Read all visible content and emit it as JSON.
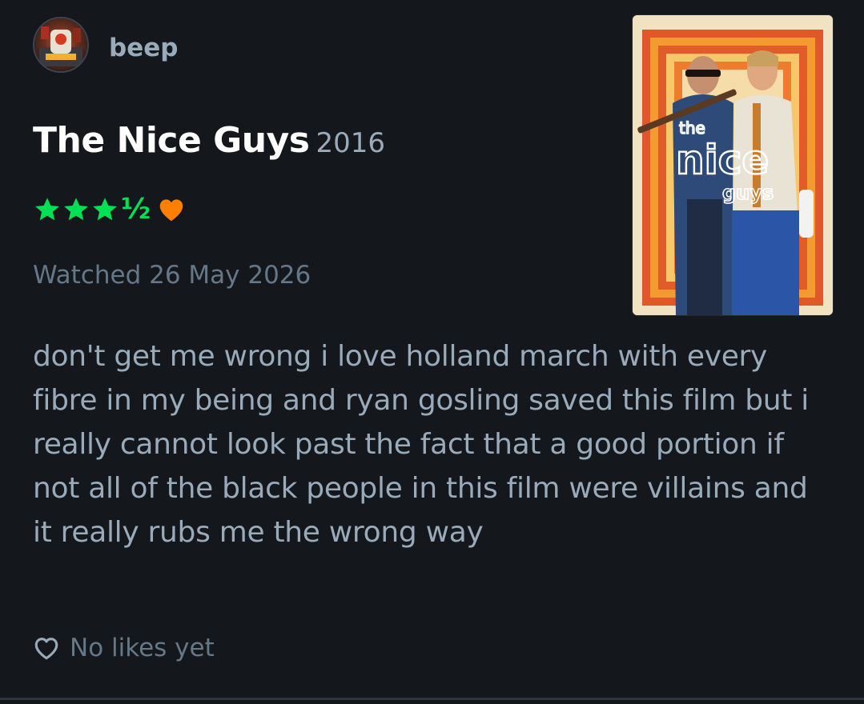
{
  "review": {
    "username": "beep",
    "film_title": "The Nice Guys",
    "film_year": "2016",
    "rating": {
      "stars": 3.5,
      "max": 5,
      "half_glyph": "½"
    },
    "liked": true,
    "watched_text": "Watched 26 May 2026",
    "body": "don't get me wrong i love holland march with every fibre in my being and ryan gosling saved this film but i really cannot look past the fact that a good portion if not all of the black people in this film were villains and it really rubs me the wrong way",
    "likes_text": "No likes yet",
    "poster": {
      "logo_small": "the",
      "logo_main": "nice",
      "logo_sub": "guys"
    }
  },
  "colors": {
    "background": "#14181c",
    "star_green": "#00e054",
    "heart_orange": "#ff8000",
    "text_primary": "#ffffff",
    "text_secondary": "#99aabb",
    "text_muted": "#667788"
  },
  "icons": [
    "avatar-image",
    "star-icon",
    "heart-filled-icon",
    "heart-outline-icon"
  ]
}
